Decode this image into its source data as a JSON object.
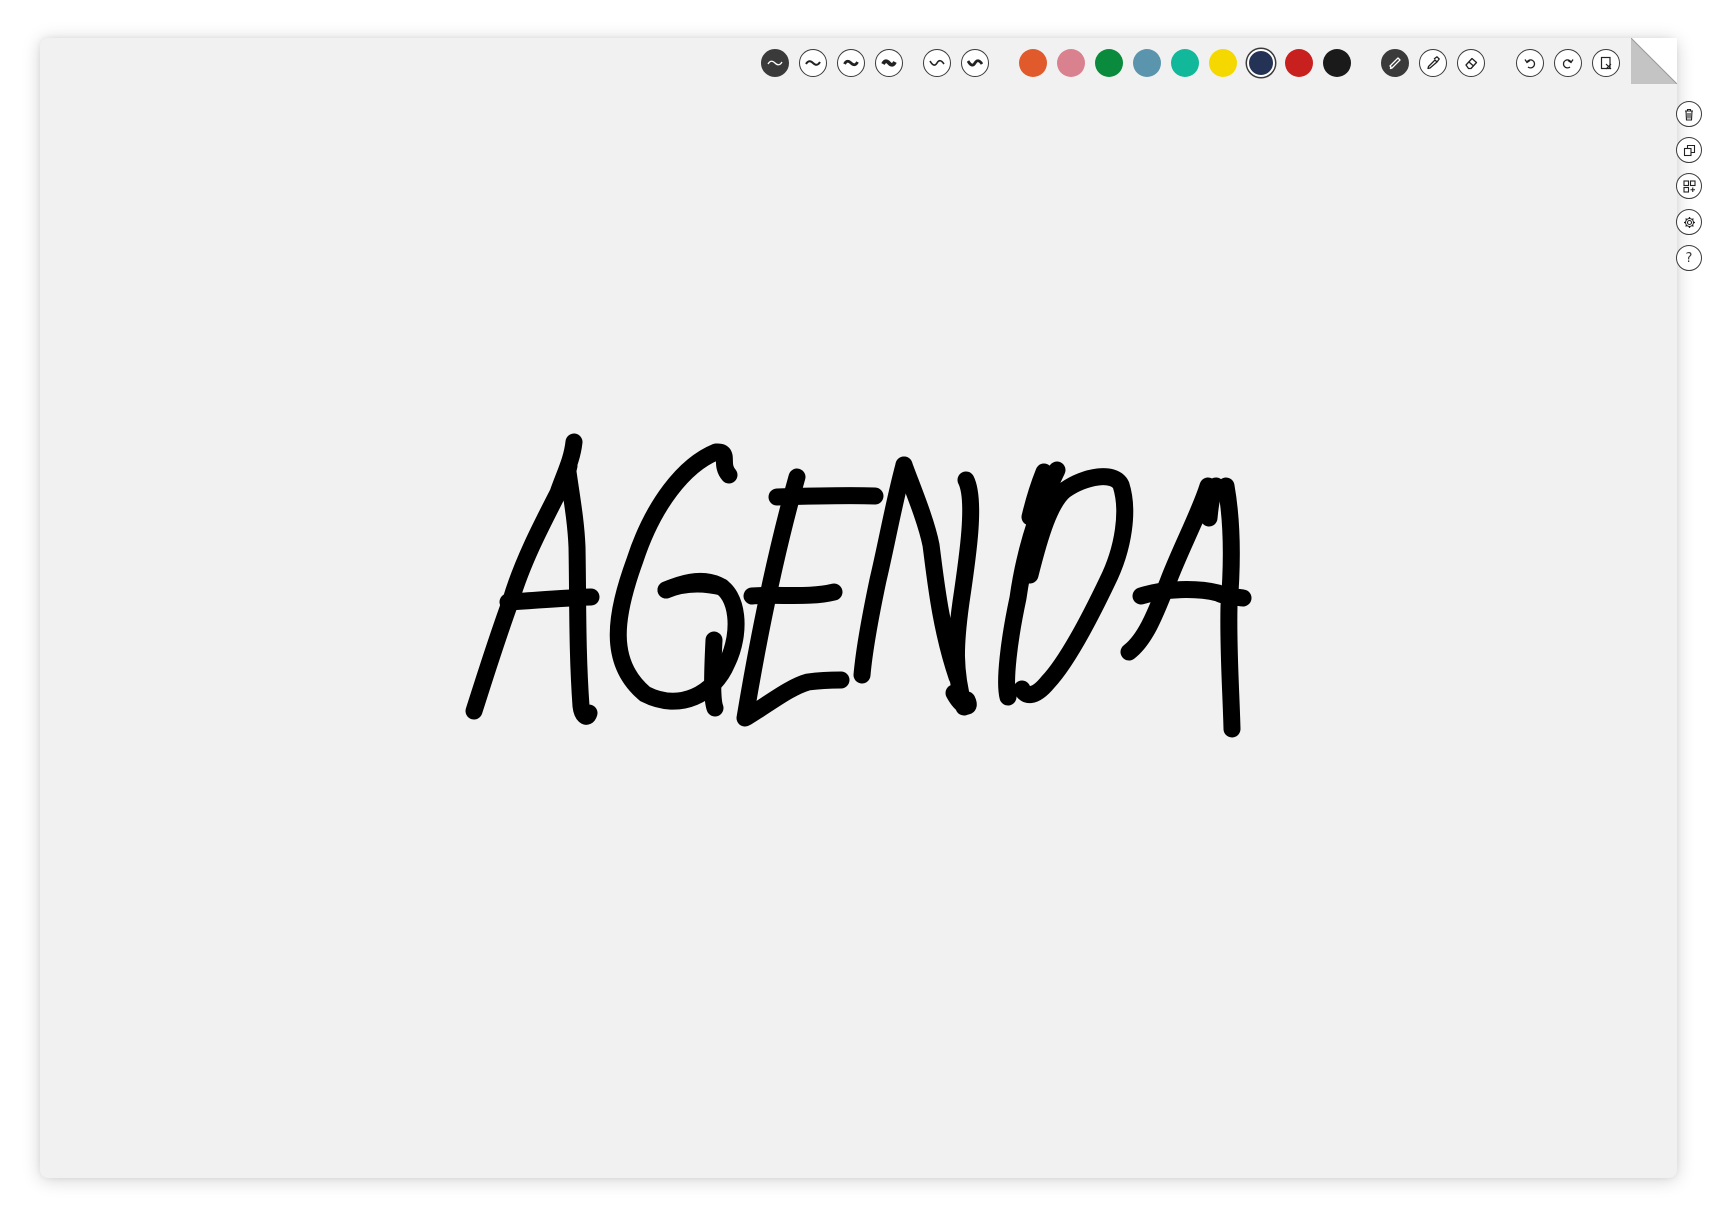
{
  "toolbar": {
    "stroke_widths": [
      {
        "name": "stroke-thin",
        "active": true
      },
      {
        "name": "stroke-medium",
        "active": false
      },
      {
        "name": "stroke-thick",
        "active": false
      },
      {
        "name": "stroke-heavy",
        "active": false
      }
    ],
    "smoothing": [
      {
        "name": "smooth-low"
      },
      {
        "name": "smooth-high"
      }
    ],
    "colors": [
      {
        "name": "orange",
        "hex": "#e05a2b",
        "selected": false
      },
      {
        "name": "pink",
        "hex": "#d9818f",
        "selected": false
      },
      {
        "name": "green",
        "hex": "#0a8a3c",
        "selected": false
      },
      {
        "name": "steel-blue",
        "hex": "#5a95ad",
        "selected": false
      },
      {
        "name": "teal",
        "hex": "#12b89a",
        "selected": false
      },
      {
        "name": "yellow",
        "hex": "#f5d800",
        "selected": false
      },
      {
        "name": "navy",
        "hex": "#233255",
        "selected": true
      },
      {
        "name": "red",
        "hex": "#c8201f",
        "selected": false
      },
      {
        "name": "black",
        "hex": "#1a1a1a",
        "selected": false
      }
    ],
    "tools": [
      "pencil-icon",
      "marker-icon",
      "eraser-icon"
    ],
    "active_tool": "pencil",
    "history": [
      "undo-icon",
      "redo-icon",
      "clear-page-icon"
    ]
  },
  "side_menu": [
    "trash-icon",
    "duplicate-icon",
    "pages-icon",
    "settings-icon",
    "help-icon"
  ],
  "side_labels": {
    "help": "?"
  },
  "canvas": {
    "handwritten_text": "AGENDA",
    "ink_color": "#000000"
  }
}
